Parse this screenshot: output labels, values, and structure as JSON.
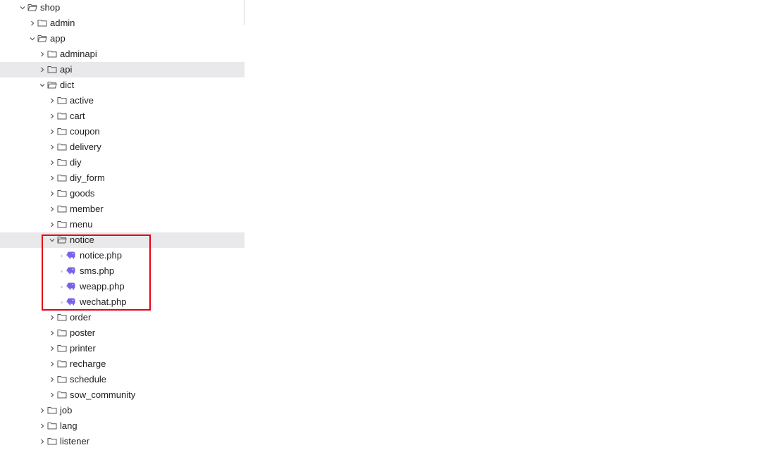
{
  "explorer": {
    "rows": [
      {
        "label": "shop",
        "kind": "folder",
        "expanded": true
      },
      {
        "label": "admin",
        "kind": "folder",
        "expanded": false
      },
      {
        "label": "app",
        "kind": "folder",
        "expanded": true
      },
      {
        "label": "adminapi",
        "kind": "folder",
        "expanded": false
      },
      {
        "label": "api",
        "kind": "folder",
        "expanded": false,
        "highlighted": true
      },
      {
        "label": "dict",
        "kind": "folder",
        "expanded": true
      },
      {
        "label": "active",
        "kind": "folder",
        "expanded": false
      },
      {
        "label": "cart",
        "kind": "folder",
        "expanded": false
      },
      {
        "label": "coupon",
        "kind": "folder",
        "expanded": false
      },
      {
        "label": "delivery",
        "kind": "folder",
        "expanded": false
      },
      {
        "label": "diy",
        "kind": "folder",
        "expanded": false
      },
      {
        "label": "diy_form",
        "kind": "folder",
        "expanded": false
      },
      {
        "label": "goods",
        "kind": "folder",
        "expanded": false
      },
      {
        "label": "member",
        "kind": "folder",
        "expanded": false
      },
      {
        "label": "menu",
        "kind": "folder",
        "expanded": false
      },
      {
        "label": "notice",
        "kind": "folder",
        "expanded": true,
        "highlighted": true
      },
      {
        "label": "notice.php",
        "kind": "php-file"
      },
      {
        "label": "sms.php",
        "kind": "php-file"
      },
      {
        "label": "weapp.php",
        "kind": "php-file"
      },
      {
        "label": "wechat.php",
        "kind": "php-file"
      },
      {
        "label": "order",
        "kind": "folder",
        "expanded": false
      },
      {
        "label": "poster",
        "kind": "folder",
        "expanded": false
      },
      {
        "label": "printer",
        "kind": "folder",
        "expanded": false
      },
      {
        "label": "recharge",
        "kind": "folder",
        "expanded": false
      },
      {
        "label": "schedule",
        "kind": "folder",
        "expanded": false
      },
      {
        "label": "sow_community",
        "kind": "folder",
        "expanded": false
      },
      {
        "label": "job",
        "kind": "folder",
        "expanded": false
      },
      {
        "label": "lang",
        "kind": "folder",
        "expanded": false
      },
      {
        "label": "listener",
        "kind": "folder",
        "expanded": false
      }
    ]
  },
  "colors": {
    "highlight_row": "#e9e9ec",
    "annotation_box": "#e60012",
    "php_icon": "#7b61e8",
    "folder_icon": "#555555"
  }
}
